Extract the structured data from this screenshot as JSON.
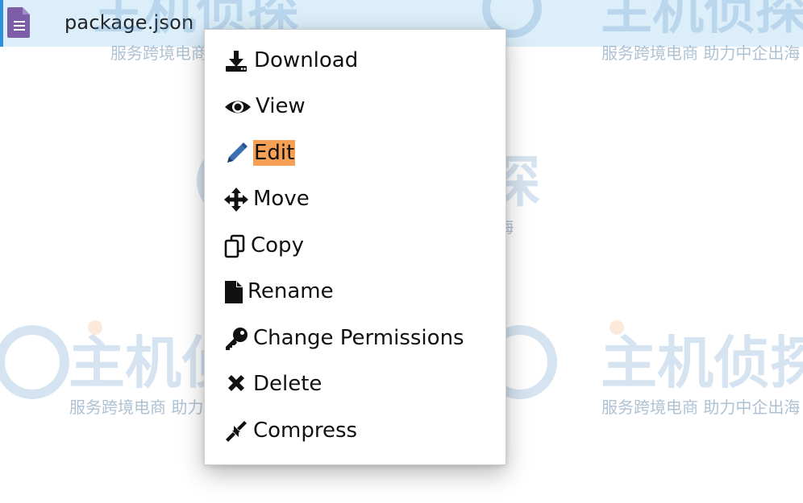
{
  "file": {
    "name": "package.json",
    "icon": "document-icon",
    "icon_color": "#7b5ea7"
  },
  "menu": {
    "items": [
      {
        "label": "Download",
        "icon": "download-icon"
      },
      {
        "label": "View",
        "icon": "eye-icon"
      },
      {
        "label": "Edit",
        "icon": "pencil-icon",
        "highlighted": true,
        "highlight_color": "#f5a054"
      },
      {
        "label": "Move",
        "icon": "move-arrows-icon"
      },
      {
        "label": "Copy",
        "icon": "copy-icon"
      },
      {
        "label": "Rename",
        "icon": "file-icon"
      },
      {
        "label": "Change Permissions",
        "icon": "key-icon"
      },
      {
        "label": "Delete",
        "icon": "x-icon"
      },
      {
        "label": "Compress",
        "icon": "compress-icon"
      }
    ]
  },
  "watermark": {
    "caption": "服务跨境电商 助力中企出海",
    "color": "#6d8fb0"
  },
  "colors": {
    "row_background": "#dbeef9",
    "row_accent": "#2f8fd8",
    "pencil": "#3a6fb0"
  }
}
